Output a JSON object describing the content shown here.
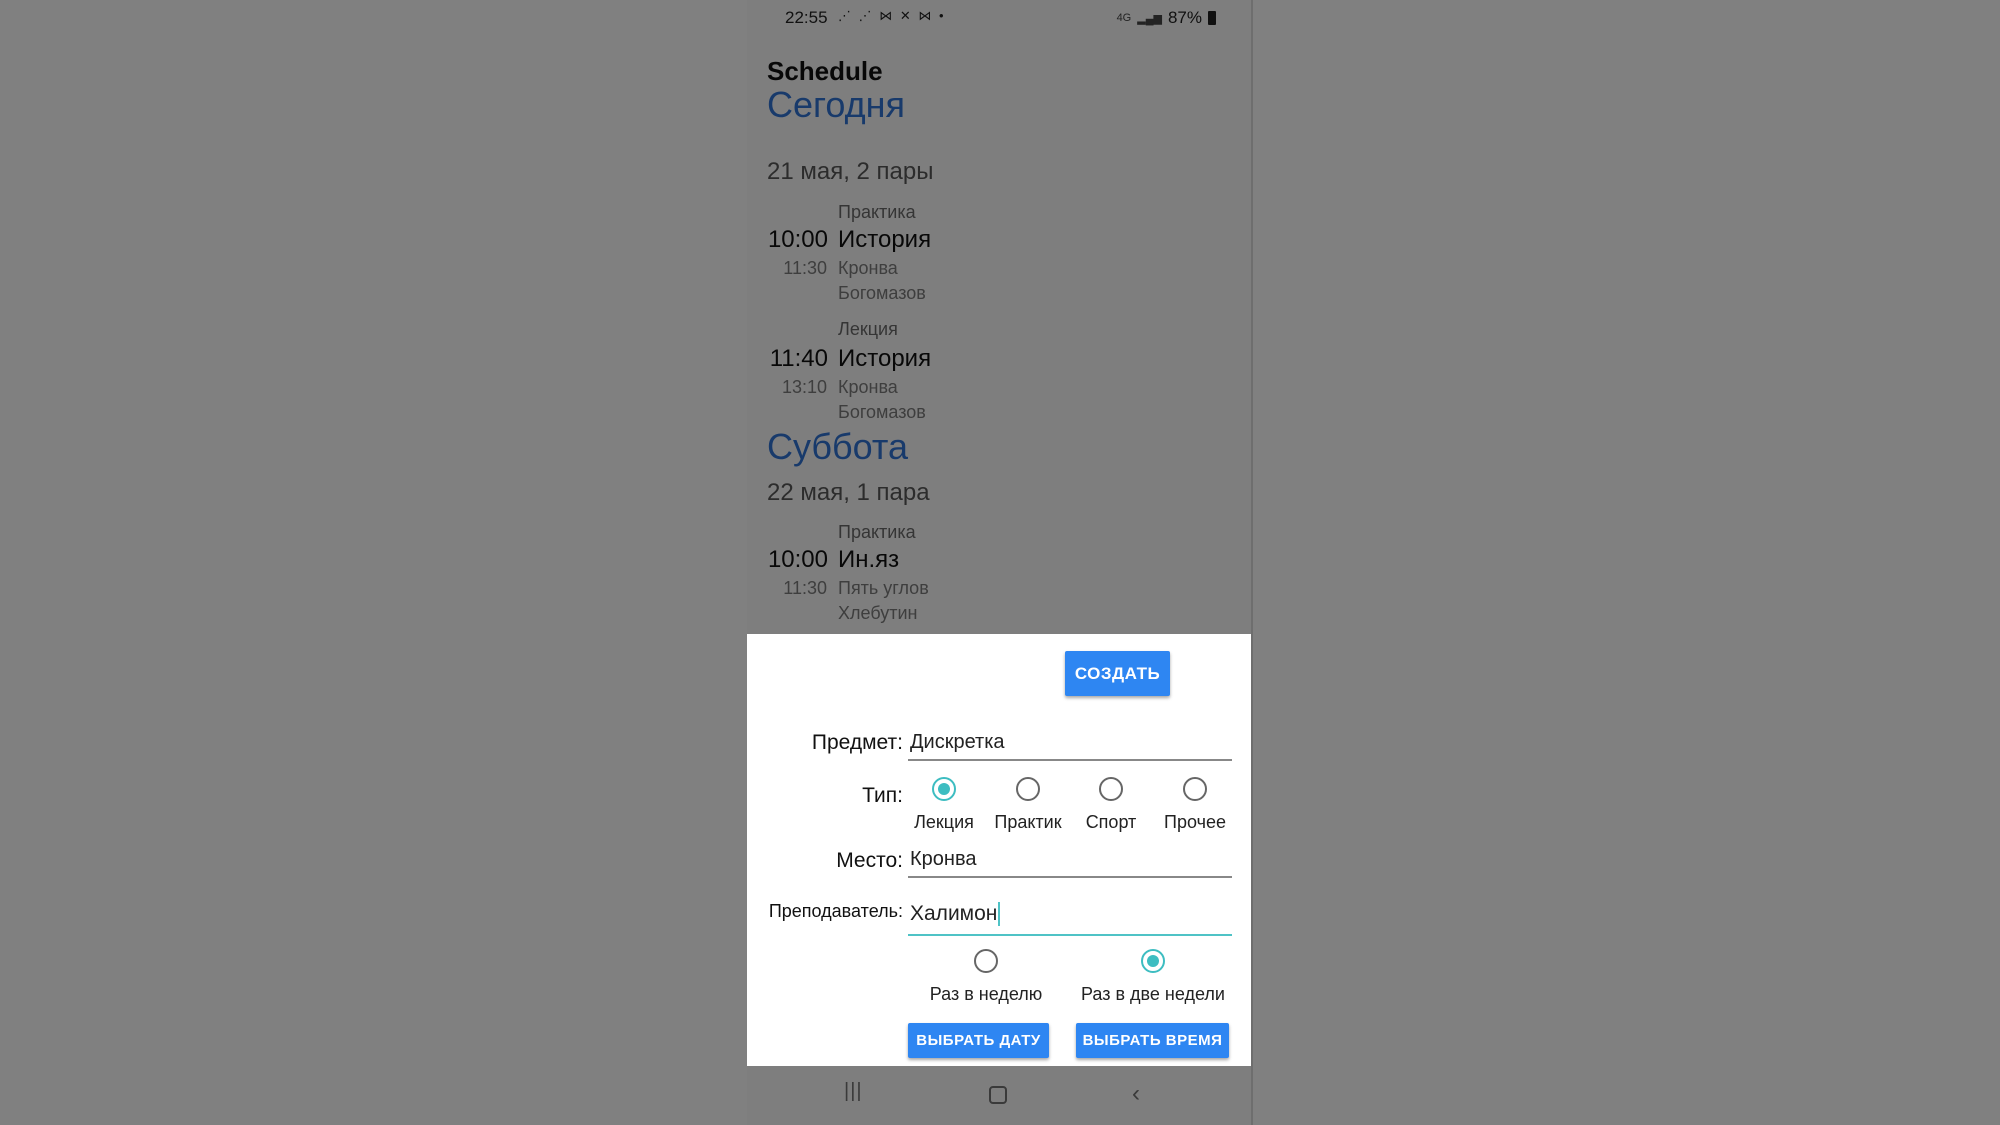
{
  "status_bar": {
    "time": "22:55",
    "left_icons": "⋰ ⋰ ⋈ ✕ ⋈ •",
    "network": "4G",
    "battery": "87%"
  },
  "app_bar": {
    "title": "Schedule"
  },
  "schedule": {
    "days": [
      {
        "heading": "Сегодня",
        "subtitle": "21 мая, 2 пары",
        "classes": [
          {
            "type": "Практика",
            "start": "10:00",
            "name": "История",
            "end": "11:30",
            "place": "Кронва",
            "teacher": "Богомазов"
          },
          {
            "type": "Лекция",
            "start": "11:40",
            "name": "История",
            "end": "13:10",
            "place": "Кронва",
            "teacher": "Богомазов"
          }
        ]
      },
      {
        "heading": "Суббота",
        "subtitle": "22 мая, 1 пара",
        "classes": [
          {
            "type": "Практика",
            "start": "10:00",
            "name": "Ин.яз",
            "end": "11:30",
            "place": "Пять углов",
            "teacher": "Хлебутин"
          }
        ]
      }
    ]
  },
  "dialog": {
    "create_button": "СОЗДАТЬ",
    "subject_label": "Предмет:",
    "subject_value": "Дискретка",
    "type_label": "Тип:",
    "type_options": [
      "Лекция",
      "Практик",
      "Спорт",
      "Прочее"
    ],
    "type_selected": "Лекция",
    "place_label": "Место:",
    "place_value": "Кронва",
    "teacher_label": "Преподаватель:",
    "teacher_value": "Халимон",
    "frequency_options": [
      "Раз в неделю",
      "Раз в две недели"
    ],
    "frequency_selected": "Раз в две недели",
    "pick_date_button": "ВЫБРАТЬ ДАТУ",
    "pick_time_button": "ВЫБРАТЬ ВРЕМЯ"
  },
  "nav_bar": {
    "recent": "|||",
    "back": "‹"
  },
  "colors": {
    "accent": "#2e86f2",
    "heading": "#2e6fce",
    "radio": "#3dbdc1"
  }
}
